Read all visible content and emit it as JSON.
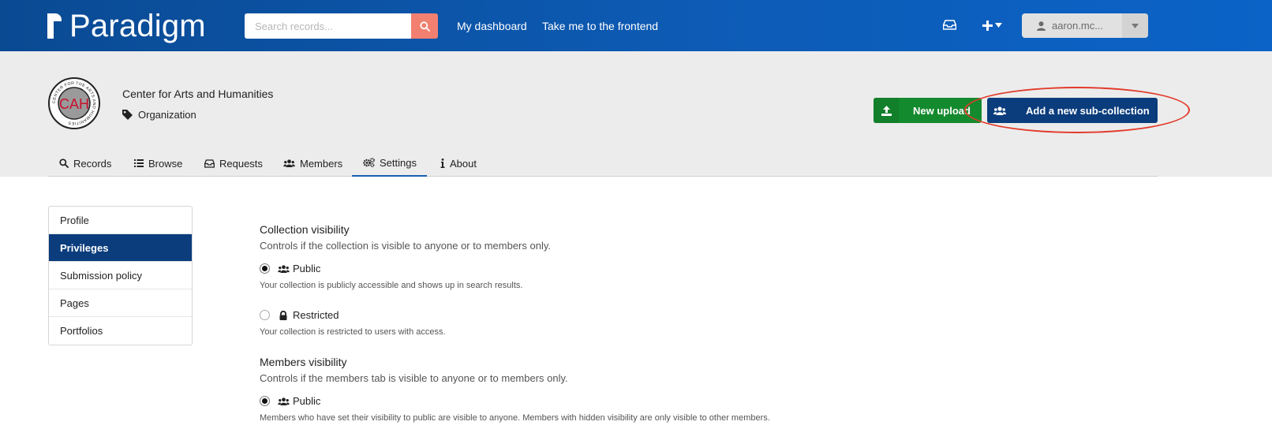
{
  "app": {
    "name": "Paradigm"
  },
  "search": {
    "placeholder": "Search records..."
  },
  "topnav": {
    "dashboard": "My dashboard",
    "frontend": "Take me to the frontend",
    "user": "aaron.mc..."
  },
  "org": {
    "name": "Center for Arts and Humanities",
    "type": "Organization",
    "logo_text": "CAH",
    "logo_ring_text": "CENTER FOR THE ARTS AND HUMANITIES"
  },
  "actions": {
    "new_upload": "New upload",
    "add_sub_collection": "Add a new sub-collection"
  },
  "tabs": [
    {
      "label": "Records",
      "icon": "search-icon"
    },
    {
      "label": "Browse",
      "icon": "list-icon"
    },
    {
      "label": "Requests",
      "icon": "inbox-icon"
    },
    {
      "label": "Members",
      "icon": "users-icon"
    },
    {
      "label": "Settings",
      "icon": "gears-icon",
      "active": true
    },
    {
      "label": "About",
      "icon": "info-icon"
    }
  ],
  "sidebar": {
    "items": [
      {
        "label": "Profile"
      },
      {
        "label": "Privileges",
        "active": true
      },
      {
        "label": "Submission policy"
      },
      {
        "label": "Pages"
      },
      {
        "label": "Portfolios"
      }
    ]
  },
  "collection_visibility": {
    "title": "Collection visibility",
    "description": "Controls if the collection is visible to anyone or to members only.",
    "options": [
      {
        "label": "Public",
        "help": "Your collection is publicly accessible and shows up in search results.",
        "checked": true,
        "icon": "users-icon"
      },
      {
        "label": "Restricted",
        "help": "Your collection is restricted to users with access.",
        "checked": false,
        "icon": "lock-icon"
      }
    ]
  },
  "members_visibility": {
    "title": "Members visibility",
    "description": "Controls if the members tab is visible to anyone or to members only.",
    "options": [
      {
        "label": "Public",
        "help": "Members who have set their visibility to public are visible to anyone. Members with hidden visibility are only visible to other members.",
        "checked": true,
        "icon": "users-icon"
      }
    ]
  },
  "colors": {
    "topbar": "#0d5bb5",
    "primary_dark": "#0b3d7d",
    "success": "#148a2e",
    "search_button": "#f28070",
    "annotation": "#e23a2a"
  }
}
